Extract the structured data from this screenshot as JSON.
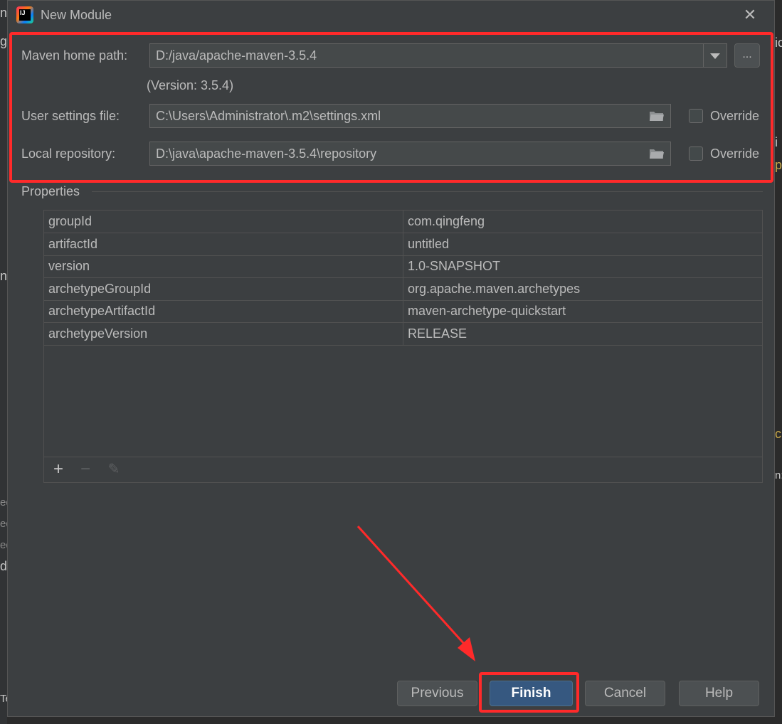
{
  "window": {
    "title": "New Module",
    "close_label": "✕"
  },
  "maven": {
    "home_label": "Maven home path:",
    "home_value": "D:/java/apache-maven-3.5.4",
    "dots_label": "...",
    "version_text": "(Version: 3.5.4)",
    "settings_label": "User settings file:",
    "settings_value": "C:\\Users\\Administrator\\.m2\\settings.xml",
    "repo_label": "Local repository:",
    "repo_value": "D:\\java\\apache-maven-3.5.4\\repository",
    "override_label": "Override"
  },
  "properties": {
    "heading": "Properties",
    "rows": [
      {
        "key": "groupId",
        "value": "com.qingfeng"
      },
      {
        "key": "artifactId",
        "value": "untitled"
      },
      {
        "key": "version",
        "value": "1.0-SNAPSHOT"
      },
      {
        "key": "archetypeGroupId",
        "value": "org.apache.maven.archetypes"
      },
      {
        "key": "archetypeArtifactId",
        "value": "maven-archetype-quickstart"
      },
      {
        "key": "archetypeVersion",
        "value": "RELEASE"
      }
    ],
    "toolbar": {
      "add": "+",
      "remove": "−",
      "edit": "✎"
    }
  },
  "buttons": {
    "previous": "Previous",
    "finish": "Finish",
    "cancel": "Cancel",
    "help": "Help"
  },
  "annotation": {
    "highlight_color": "#ff2a2a"
  },
  "background_fragments": [
    "n",
    "gf",
    "n",
    "ed",
    "ed",
    "ed",
    "d",
    "Te",
    "ic",
    "i",
    "p",
    "c",
    "n:"
  ]
}
